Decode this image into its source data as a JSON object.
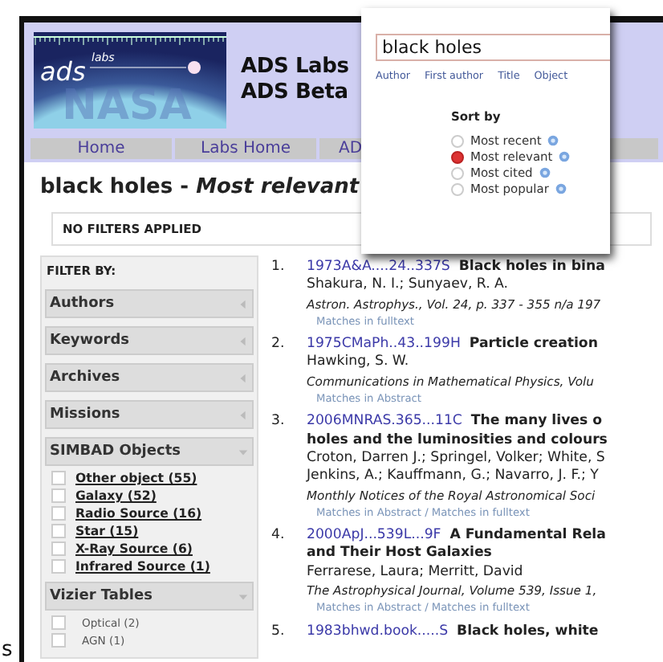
{
  "stray_text": "s",
  "header": {
    "logo": {
      "word": "ads",
      "superscript": "labs",
      "backdrop": "NASA"
    },
    "title_lines": [
      "ADS Labs",
      "ADS Beta"
    ]
  },
  "nav": [
    "Home",
    "Labs Home",
    "AD"
  ],
  "heading": {
    "query": "black holes - ",
    "sort": "Most relevant"
  },
  "filters_applied": "NO FILTERS APPLIED",
  "filter_panel": {
    "title": "FILTER BY:",
    "sections": [
      {
        "label": "Authors",
        "expanded": false
      },
      {
        "label": "Keywords",
        "expanded": false
      },
      {
        "label": "Archives",
        "expanded": false
      },
      {
        "label": "Missions",
        "expanded": false
      },
      {
        "label": "SIMBAD Objects",
        "expanded": true,
        "kind": "links",
        "items": [
          {
            "label": "Other object (55)",
            "checked": false
          },
          {
            "label": "Galaxy (52)",
            "checked": false
          },
          {
            "label": "Radio Source (16)",
            "checked": false
          },
          {
            "label": "Star (15)",
            "checked": false
          },
          {
            "label": "X-Ray Source (6)",
            "checked": false
          },
          {
            "label": "Infrared Source (1)",
            "checked": false
          }
        ]
      },
      {
        "label": "Vizier Tables",
        "expanded": true,
        "kind": "plain",
        "items": [
          {
            "label": "Optical (2)",
            "checked": false
          },
          {
            "label": "AGN (1)",
            "checked": false
          }
        ]
      }
    ]
  },
  "results": [
    {
      "number": "1.",
      "bibcode": "1973A&A....24..337S",
      "title": [
        "Black holes in bina"
      ],
      "authors": [
        "Shakura, N. I.; Sunyaev, R. A."
      ],
      "journal": "Astron. Astrophys., Vol. 24, p. 337 - 355  n/a 197",
      "matches": "Matches in fulltext"
    },
    {
      "number": "2.",
      "bibcode": "1975CMaPh..43..199H",
      "title": [
        "Particle creation"
      ],
      "authors": [
        "Hawking, S. W."
      ],
      "journal": "Communications in Mathematical Physics, Volu",
      "matches": "Matches in Abstract"
    },
    {
      "number": "3.",
      "bibcode": "2006MNRAS.365...11C",
      "title": [
        "The many lives o",
        "holes and the luminosities and colours"
      ],
      "authors": [
        "Croton, Darren J.; Springel, Volker; White, S",
        "Jenkins, A.; Kauffmann, G.; Navarro, J. F.; Y"
      ],
      "journal": "Monthly Notices of the Royal Astronomical Soci",
      "matches": "Matches in Abstract / Matches in fulltext"
    },
    {
      "number": "4.",
      "bibcode": "2000ApJ...539L...9F",
      "title": [
        "A Fundamental Rela",
        "and Their Host Galaxies"
      ],
      "authors": [
        "Ferrarese, Laura; Merritt, David"
      ],
      "journal": "The Astrophysical Journal, Volume 539, Issue 1,",
      "matches": "Matches in Abstract / Matches in fulltext"
    },
    {
      "number": "5.",
      "bibcode": "1983bhwd.book.....S",
      "title": [
        "Black holes, white"
      ]
    }
  ],
  "search_popup": {
    "query": "black holes",
    "fields": [
      "Author",
      "First author",
      "Title",
      "Object"
    ],
    "sort_title": "Sort by",
    "sort_options": [
      {
        "label": "Most recent",
        "selected": false
      },
      {
        "label": "Most relevant",
        "selected": true
      },
      {
        "label": "Most cited",
        "selected": false
      },
      {
        "label": "Most popular",
        "selected": false
      }
    ]
  }
}
